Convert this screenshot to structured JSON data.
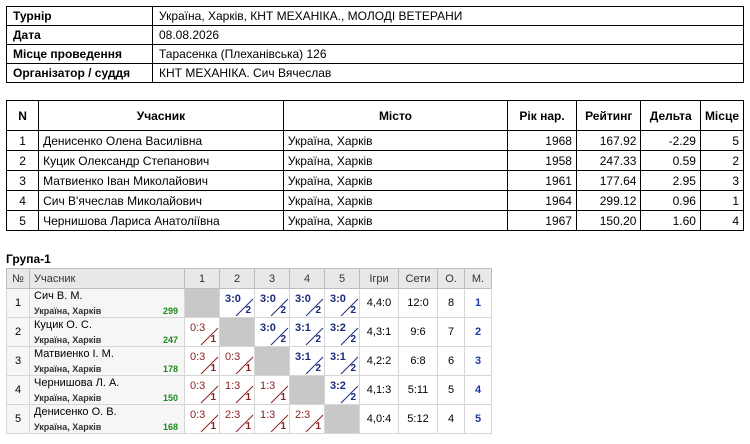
{
  "info": [
    {
      "label": "Турнір",
      "value": "Україна, Харків, КНТ МЕХАНІКА., МОЛОДІ ВЕТЕРАНИ"
    },
    {
      "label": "Дата",
      "value": "08.08.2026"
    },
    {
      "label": "Місце проведення",
      "value": "Тарасенка (Плеханівська) 126"
    },
    {
      "label": "Організатор / суддя",
      "value": "КНТ МЕХАНІКА. Сич Вячеслав"
    }
  ],
  "players_table": {
    "headers": [
      "N",
      "Учасник",
      "Місто",
      "Рік нар.",
      "Рейтинг",
      "Дельта",
      "Місце"
    ],
    "rows": [
      {
        "n": "1",
        "name": "Денисенко Олена Василівна",
        "city": "Україна, Харків",
        "year": "1968",
        "rating": "167.92",
        "delta": "-2.29",
        "place": "5"
      },
      {
        "n": "2",
        "name": "Куцик Олександр Степанович",
        "city": "Україна, Харків",
        "year": "1958",
        "rating": "247.33",
        "delta": "0.59",
        "place": "2"
      },
      {
        "n": "3",
        "name": "Матвиенко Іван Миколайович",
        "city": "Україна, Харків",
        "year": "1961",
        "rating": "177.64",
        "delta": "2.95",
        "place": "3"
      },
      {
        "n": "4",
        "name": "Сич В'ячеслав Миколайович",
        "city": "Україна, Харків",
        "year": "1964",
        "rating": "299.12",
        "delta": "0.96",
        "place": "1"
      },
      {
        "n": "5",
        "name": "Чернишова Лариса Анатоліївна",
        "city": "Україна, Харків",
        "year": "1967",
        "rating": "150.20",
        "delta": "1.60",
        "place": "4"
      }
    ]
  },
  "group": {
    "title": "Група-1",
    "headers": [
      "№",
      "Учасник",
      "1",
      "2",
      "3",
      "4",
      "5",
      "Ігри",
      "Сети",
      "О.",
      "М."
    ],
    "rows": [
      {
        "n": "1",
        "name": "Сич В. М.",
        "city": "Україна, Харків",
        "rating": "299",
        "cells": [
          null,
          {
            "s": "3:0",
            "p": "2",
            "w": true
          },
          {
            "s": "3:0",
            "p": "2",
            "w": true
          },
          {
            "s": "3:0",
            "p": "2",
            "w": true
          },
          {
            "s": "3:0",
            "p": "2",
            "w": true
          }
        ],
        "games": "4,4:0",
        "sets": "12:0",
        "points": "8",
        "place": "1"
      },
      {
        "n": "2",
        "name": "Куцик О. С.",
        "city": "Україна, Харків",
        "rating": "247",
        "cells": [
          {
            "s": "0:3",
            "p": "1",
            "w": false
          },
          null,
          {
            "s": "3:0",
            "p": "2",
            "w": true
          },
          {
            "s": "3:1",
            "p": "2",
            "w": true
          },
          {
            "s": "3:2",
            "p": "2",
            "w": true
          }
        ],
        "games": "4,3:1",
        "sets": "9:6",
        "points": "7",
        "place": "2"
      },
      {
        "n": "3",
        "name": "Матвиенко І. М.",
        "city": "Україна, Харків",
        "rating": "178",
        "cells": [
          {
            "s": "0:3",
            "p": "1",
            "w": false
          },
          {
            "s": "0:3",
            "p": "1",
            "w": false
          },
          null,
          {
            "s": "3:1",
            "p": "2",
            "w": true
          },
          {
            "s": "3:1",
            "p": "2",
            "w": true
          }
        ],
        "games": "4,2:2",
        "sets": "6:8",
        "points": "6",
        "place": "3"
      },
      {
        "n": "4",
        "name": "Чернишова Л. А.",
        "city": "Україна, Харків",
        "rating": "150",
        "cells": [
          {
            "s": "0:3",
            "p": "1",
            "w": false
          },
          {
            "s": "1:3",
            "p": "1",
            "w": false
          },
          {
            "s": "1:3",
            "p": "1",
            "w": false
          },
          null,
          {
            "s": "3:2",
            "p": "2",
            "w": true
          }
        ],
        "games": "4,1:3",
        "sets": "5:11",
        "points": "5",
        "place": "4"
      },
      {
        "n": "5",
        "name": "Денисенко О. В.",
        "city": "Україна, Харків",
        "rating": "168",
        "cells": [
          {
            "s": "0:3",
            "p": "1",
            "w": false
          },
          {
            "s": "2:3",
            "p": "1",
            "w": false
          },
          {
            "s": "1:3",
            "p": "1",
            "w": false
          },
          {
            "s": "2:3",
            "p": "1",
            "w": false
          },
          null
        ],
        "games": "4,0:4",
        "sets": "5:12",
        "points": "4",
        "place": "5"
      }
    ]
  },
  "colors": {
    "win": "#1a2a7c",
    "loss": "#8a2222",
    "rating": "#1a8a1a",
    "place": "#1c3aa6",
    "self_cell": "#c8c8c8"
  }
}
